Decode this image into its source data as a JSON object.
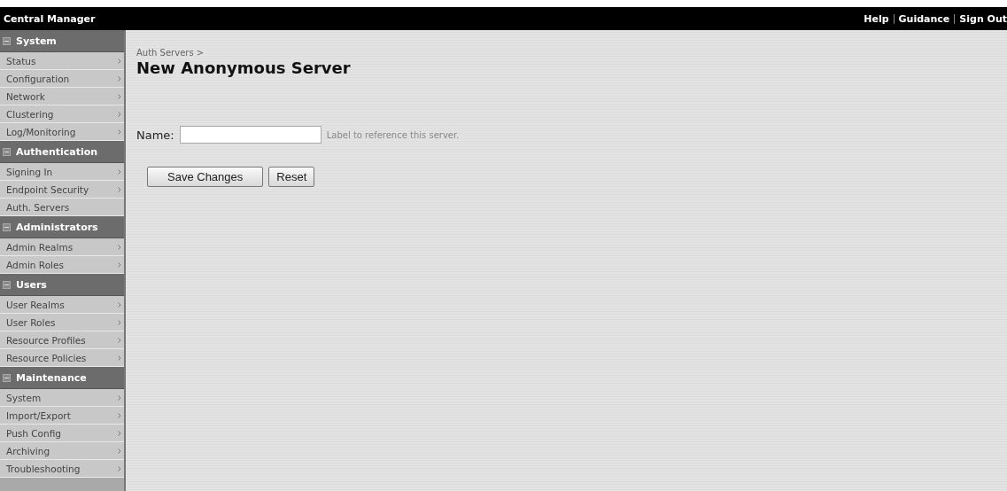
{
  "header": {
    "title": "Central Manager",
    "links": [
      "Help",
      "Guidance",
      "Sign Out"
    ]
  },
  "sidebar": {
    "groups": [
      {
        "label": "System",
        "expanded": true,
        "items": [
          {
            "label": "Status",
            "submenu": true
          },
          {
            "label": "Configuration",
            "submenu": true
          },
          {
            "label": "Network",
            "submenu": true
          },
          {
            "label": "Clustering",
            "submenu": true
          },
          {
            "label": "Log/Monitoring",
            "submenu": true
          }
        ]
      },
      {
        "label": "Authentication",
        "expanded": true,
        "items": [
          {
            "label": "Signing In",
            "submenu": true
          },
          {
            "label": "Endpoint Security",
            "submenu": true
          },
          {
            "label": "Auth. Servers",
            "submenu": false
          }
        ]
      },
      {
        "label": "Administrators",
        "expanded": true,
        "items": [
          {
            "label": "Admin Realms",
            "submenu": true
          },
          {
            "label": "Admin Roles",
            "submenu": true
          }
        ]
      },
      {
        "label": "Users",
        "expanded": true,
        "items": [
          {
            "label": "User Realms",
            "submenu": true
          },
          {
            "label": "User Roles",
            "submenu": true
          },
          {
            "label": "Resource Profiles",
            "submenu": true
          },
          {
            "label": "Resource Policies",
            "submenu": true
          }
        ]
      },
      {
        "label": "Maintenance",
        "expanded": true,
        "items": [
          {
            "label": "System",
            "submenu": true
          },
          {
            "label": "Import/Export",
            "submenu": true
          },
          {
            "label": "Push Config",
            "submenu": true
          },
          {
            "label": "Archiving",
            "submenu": true
          },
          {
            "label": "Troubleshooting",
            "submenu": true
          }
        ]
      }
    ]
  },
  "breadcrumb": "Auth Servers >",
  "page_title": "New Anonymous Server",
  "form": {
    "name_label": "Name:",
    "hint": "Label to reference this server."
  },
  "buttons": [
    "Save Changes",
    "Reset"
  ]
}
